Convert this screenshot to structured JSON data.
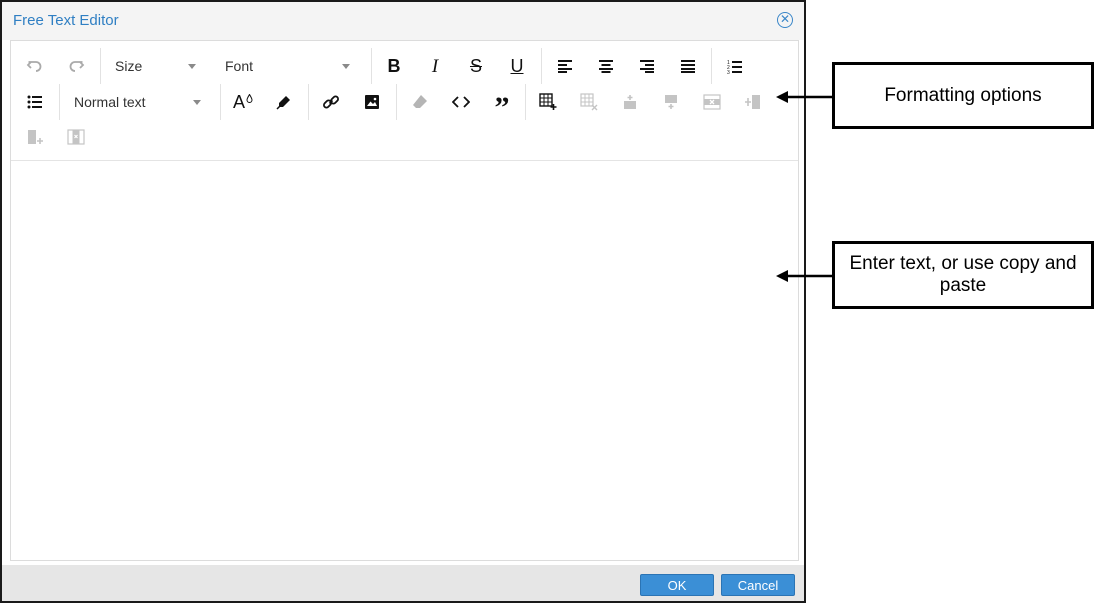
{
  "dialog": {
    "title": "Free Text Editor",
    "close_label": "✕"
  },
  "toolbar": {
    "size_label": "Size",
    "font_label": "Font",
    "bold_label": "B",
    "italic_label": "I",
    "strike_label": "S",
    "underline_label": "U",
    "paragraph_style_label": "Normal text",
    "color_label": "A",
    "quote_label": "”"
  },
  "footer": {
    "ok_label": "OK",
    "cancel_label": "Cancel"
  },
  "callouts": {
    "formatting": "Formatting options",
    "enter_text": "Enter text, or use copy and paste"
  },
  "colors": {
    "title_blue": "#2f7fc3",
    "button_blue": "#3b8fd6",
    "icon_dark": "#111111",
    "icon_disabled": "#b5b5b5"
  }
}
